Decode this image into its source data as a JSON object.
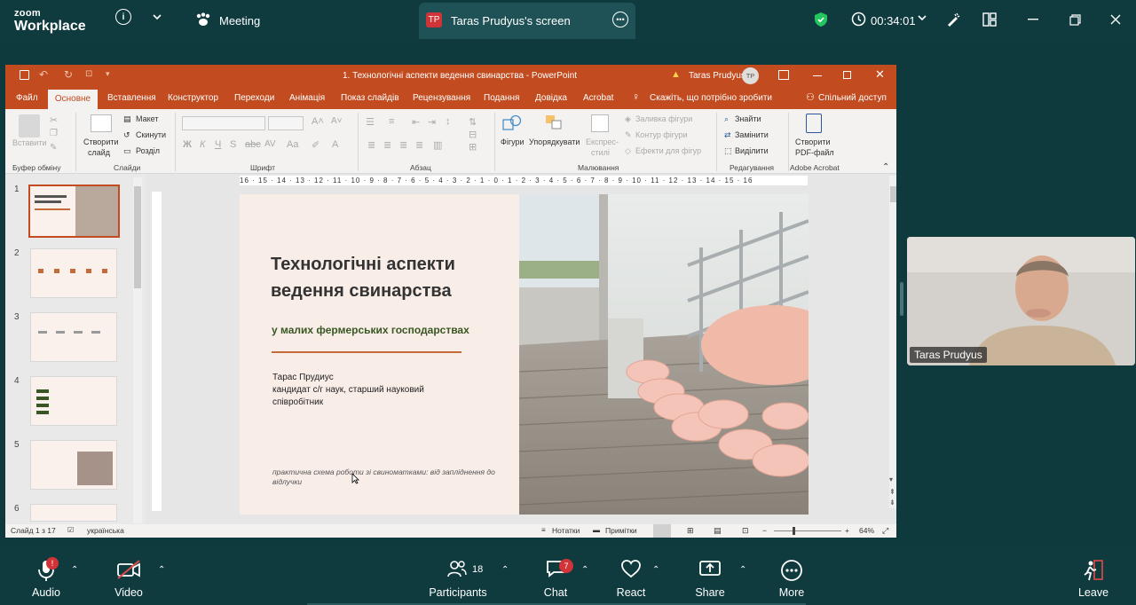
{
  "zoom": {
    "brand_top": "zoom",
    "brand_bottom": "Workplace",
    "meeting_label": "Meeting",
    "share_tab_initials": "TP",
    "share_tab_label": "Taras Prudyus's screen",
    "timer": "00:34:01"
  },
  "ppt": {
    "window_title": "1. Технологічні аспекти ведення свинарства  -  PowerPoint",
    "user_name": "Taras Prudyus",
    "user_initials": "TP",
    "menu": [
      "Файл",
      "Основне",
      "Вставлення",
      "Конструктор",
      "Переходи",
      "Анімація",
      "Показ слайдів",
      "Рецензування",
      "Подання",
      "Довідка",
      "Acrobat"
    ],
    "tell_me": "Скажіть, що потрібно зробити",
    "share": "Спільний доступ",
    "ribbon": {
      "paste": "Вставити",
      "clipboard": "Буфер обміну",
      "new_slide_1": "Створити",
      "new_slide_2": "слайд",
      "layout": "Макет",
      "reset": "Скинути",
      "section": "Розділ",
      "slides": "Слайди",
      "font": "Шрифт",
      "paragraph": "Абзац",
      "shapes": "Фігури",
      "arrange": "Упорядкувати",
      "express_1": "Експрес-",
      "express_2": "стилі",
      "shape_fill": "Заливка фігури",
      "shape_outline": "Контур фігури",
      "shape_effects": "Ефекти для фігур",
      "drawing": "Малювання",
      "find": "Знайти",
      "replace": "Замінити",
      "select": "Виділити",
      "editing": "Редагування",
      "create_pdf_1": "Створити",
      "create_pdf_2": "PDF-файл",
      "adobe": "Adobe Acrobat"
    },
    "ruler": "16 · 15 · 14 · 13 · 12 · 11 · 10 · 9 · 8 · 7 · 6 · 5 · 4 · 3 · 2 · 1 · 0 · 1 · 2 · 3 · 4 · 5 · 6 · 7 · 8 · 9 · 10 · 11 · 12 · 13 · 14 · 15 · 16",
    "thumbnails": [
      "1",
      "2",
      "3",
      "4",
      "5",
      "6"
    ],
    "slide": {
      "title_line1": "Технологічні аспекти",
      "title_line2": "ведення свинарства",
      "subtitle": "у малих фермерських господарствах",
      "author": "Тарас Прудиус",
      "author_role": "кандидат с/г наук, старший науковий співробітник",
      "note": "практична схема роботи зі свиноматками: від запліднення до відлучки"
    },
    "status": {
      "slide_counter": "Слайд 1 з 17",
      "language": "українська",
      "notes": "Нотатки",
      "comments": "Примітки",
      "zoom": "64%"
    }
  },
  "participant": {
    "name": "Taras Prudyus"
  },
  "toolbar": {
    "audio": "Audio",
    "video": "Video",
    "participants": "Participants",
    "participants_count": "18",
    "chat": "Chat",
    "chat_badge": "7",
    "react": "React",
    "share": "Share",
    "more": "More",
    "leave": "Leave"
  }
}
